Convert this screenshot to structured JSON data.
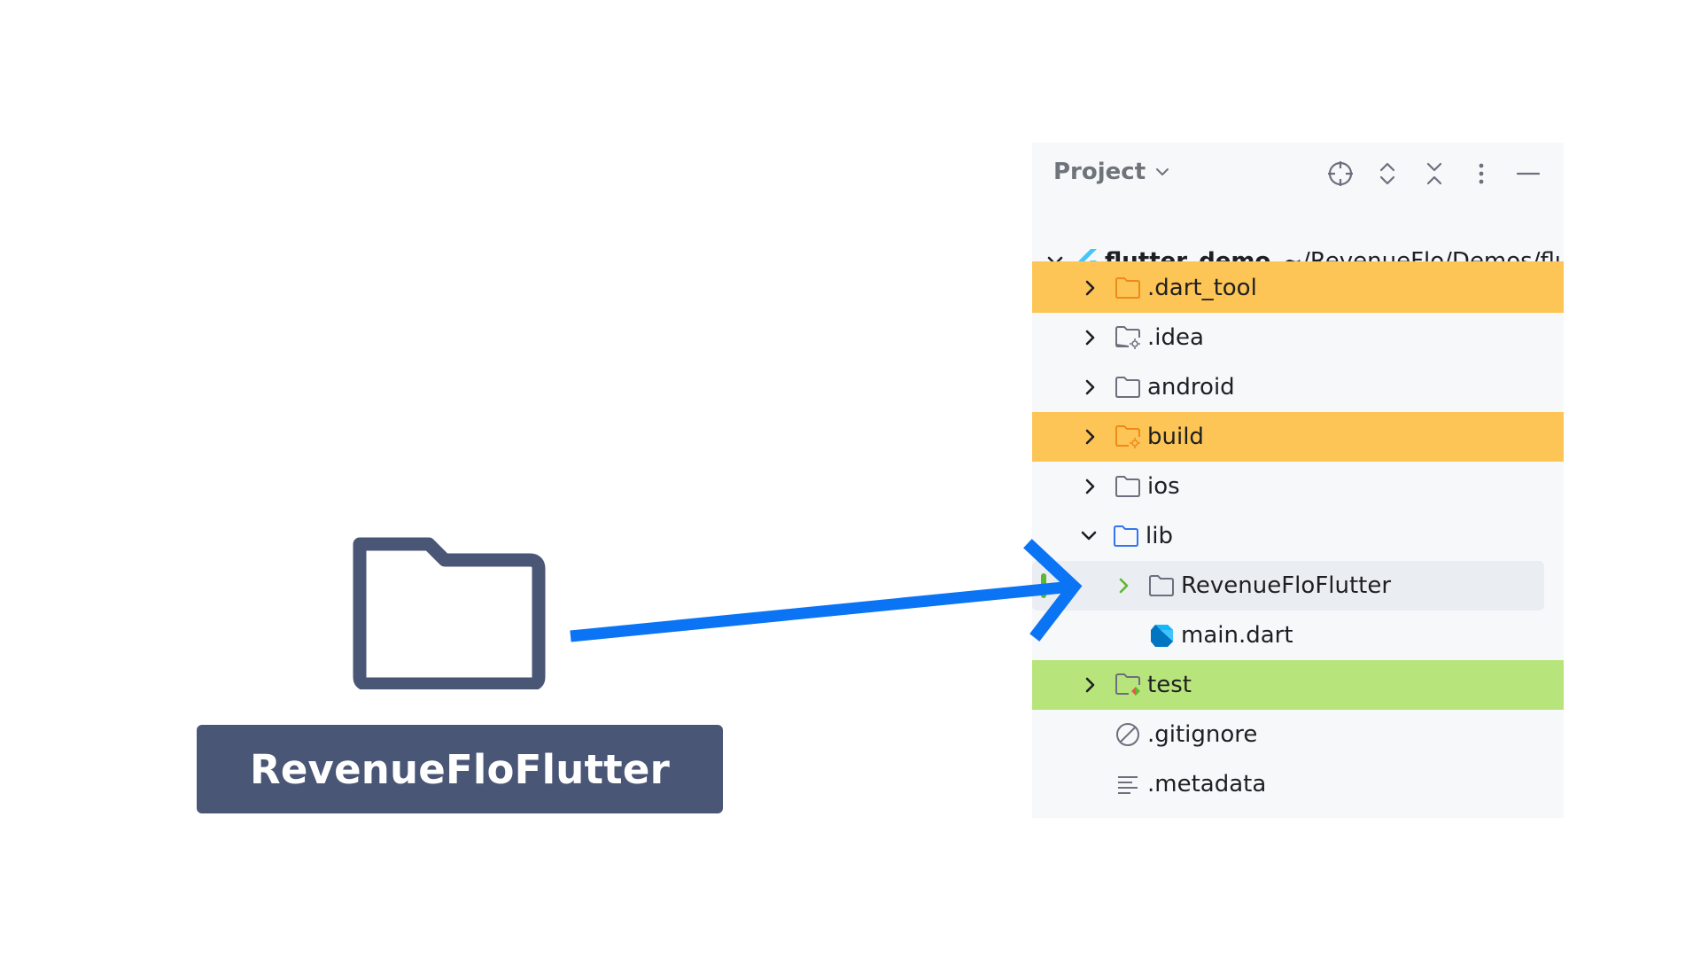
{
  "label": {
    "text": "RevenueFloFlutter"
  },
  "panel": {
    "title": "Project",
    "header_icons": [
      "crosshair-icon",
      "expand-all-icon",
      "collapse-all-icon",
      "more-vertical-icon",
      "minimize-icon"
    ],
    "root": {
      "name": "flutter_demo",
      "path": "~/RevenueFlo/Demos/flutter_demo"
    },
    "items": [
      {
        "label": ".dart_tool",
        "icon": "excluded-folder-icon",
        "highlight": "#fdc556"
      },
      {
        "label": ".idea",
        "icon": "settings-folder-icon"
      },
      {
        "label": "android",
        "icon": "folder-icon"
      },
      {
        "label": "build",
        "icon": "excluded-folder-icon",
        "highlight": "#fdc556"
      },
      {
        "label": "ios",
        "icon": "folder-icon"
      },
      {
        "label": "lib",
        "icon": "source-folder-icon"
      },
      {
        "label": "RevenueFloFlutter",
        "icon": "folder-icon"
      },
      {
        "label": "main.dart",
        "icon": "dart-file-icon"
      },
      {
        "label": "test",
        "icon": "test-folder-icon",
        "highlight": "#b7e57b"
      },
      {
        "label": ".gitignore",
        "icon": "ignore-file-icon"
      },
      {
        "label": ".metadata",
        "icon": "text-file-icon"
      }
    ]
  },
  "colors": {
    "accent_arrow": "#0a74f5",
    "label_bg": "#4a5676",
    "excluded": "#fdc556",
    "test": "#b7e57b",
    "panel_bg": "#f7f8fa"
  }
}
